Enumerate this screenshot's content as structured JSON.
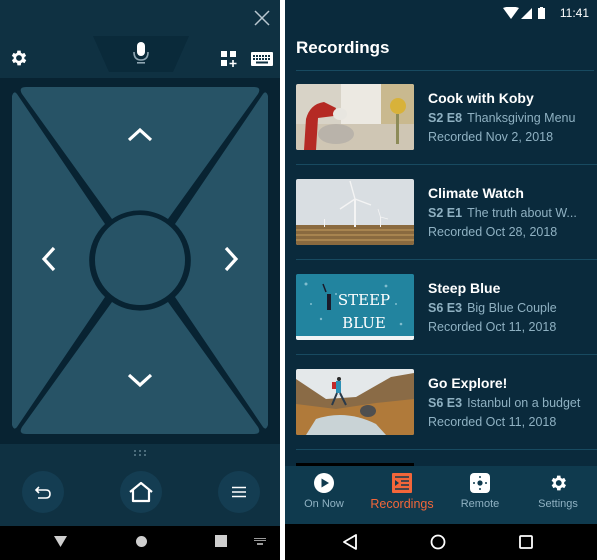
{
  "remote": {
    "close_icon": "close-icon",
    "toolbar": {
      "settings_icon": "gear-icon",
      "voice_icon": "microphone-icon",
      "apps_icon": "apps-add-icon",
      "keyboard_icon": "keyboard-icon"
    },
    "dpad": {
      "up": "chevron-up-icon",
      "down": "chevron-down-icon",
      "left": "chevron-left-icon",
      "right": "chevron-right-icon",
      "select": "select-circle"
    },
    "buttons": {
      "back_icon": "back-arrow-icon",
      "home_icon": "home-icon",
      "menu_icon": "menu-icon"
    },
    "system_nav": [
      "back-triangle-icon",
      "home-circle-icon",
      "recents-square-icon",
      "keyboard-switch-icon"
    ]
  },
  "recordings": {
    "status_bar": {
      "time": "11:41",
      "icons": [
        "wifi-icon",
        "signal-icon",
        "battery-icon"
      ]
    },
    "title": "Recordings",
    "items": [
      {
        "title": "Cook with Koby",
        "episode": "S2 E8",
        "episode_title": "Thanksgiving Menu",
        "recorded": "Recorded Nov 2, 2018",
        "thumbnail": "kitchen-mixer-thumbnail"
      },
      {
        "title": "Climate Watch",
        "episode": "S2 E1",
        "episode_title": "The truth about W...",
        "recorded": "Recorded Oct 28, 2018",
        "thumbnail": "wind-turbines-thumbnail"
      },
      {
        "title": "Steep Blue",
        "episode": "S6 E3",
        "episode_title": "Big Blue Couple",
        "recorded": "Recorded Oct 11, 2018",
        "thumbnail": "surfer-ocean-thumbnail",
        "thumbnail_text": [
          "STEEP",
          "BLUE"
        ]
      },
      {
        "title": "Go Explore!",
        "episode": "S6 E3",
        "episode_title": "Istanbul on a budget",
        "recorded": "Recorded Oct 11, 2018",
        "thumbnail": "hiker-mountains-thumbnail"
      }
    ],
    "tabs": [
      {
        "label": "On Now",
        "icon": "play-circle-icon",
        "active": false
      },
      {
        "label": "Recordings",
        "icon": "recordings-list-icon",
        "active": true
      },
      {
        "label": "Remote",
        "icon": "remote-icon",
        "active": false
      },
      {
        "label": "Settings",
        "icon": "gear-icon",
        "active": false
      }
    ],
    "system_nav": [
      "back-triangle-icon",
      "home-circle-icon",
      "recents-square-icon"
    ]
  },
  "colors": {
    "background": "#0a2a3c",
    "accent": "#f2663a",
    "secondary_text": "#8fb1c2",
    "dpad_fill": "#275366"
  }
}
